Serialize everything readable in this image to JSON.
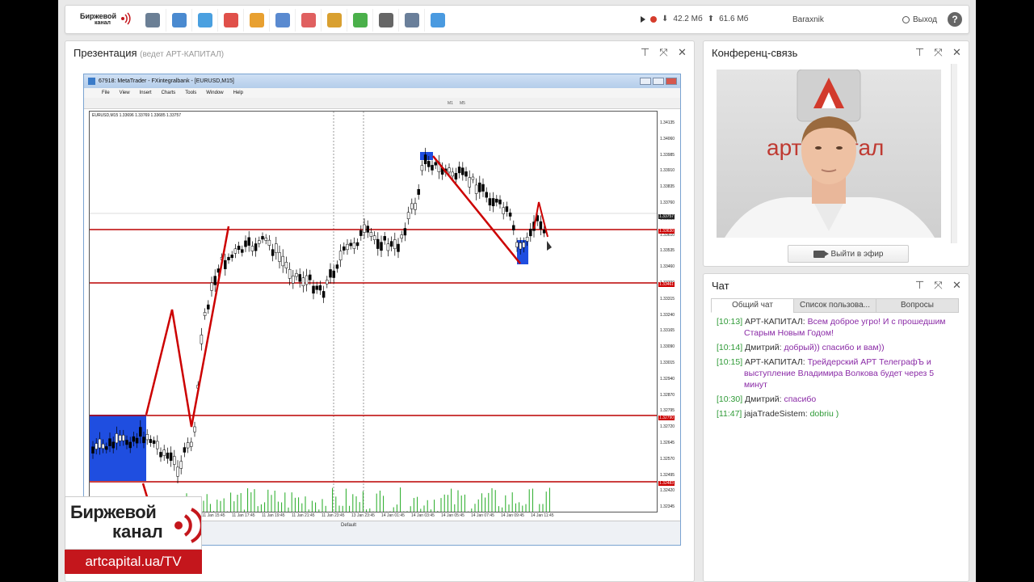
{
  "topbar": {
    "logo_line1": "Биржевой",
    "logo_line2": "канал",
    "tools": [
      "webcam-icon",
      "presentation-icon",
      "chat-bubble-icon",
      "media-icon",
      "folder-icon",
      "document-icon",
      "cube-icon",
      "notepad-icon",
      "share-icon",
      "layout-icon",
      "gear-icon",
      "add-user-icon"
    ],
    "memory_down": "42.2 Мб",
    "memory_up": "61.6 Мб",
    "username": "Baraxnik",
    "exit_label": "Выход",
    "help_label": "?"
  },
  "presentation": {
    "title": "Презентация",
    "subtitle": "(ведет АРТ-КАПИТАЛ)",
    "mt_title": "67918: MetaTrader - FXintegralbank - [EURUSD,M15]",
    "mt_menu": [
      "File",
      "View",
      "Insert",
      "Charts",
      "Tools",
      "Window",
      "Help"
    ],
    "mt_toolbar": [
      "M1",
      "M5"
    ],
    "chart_header": "EURUSD,M15  1.33696 1.33769 1.33685 1.33757",
    "price_ticks": [
      "1.34135",
      "1.34060",
      "1.33985",
      "1.33910",
      "1.33835",
      "1.33760",
      "1.33685",
      "1.33610",
      "1.33535",
      "1.33460",
      "1.33390",
      "1.33315",
      "1.33240",
      "1.33165",
      "1.33090",
      "1.33015",
      "1.32940",
      "1.32870",
      "1.32795",
      "1.32720",
      "1.32645",
      "1.32570",
      "1.32495",
      "1.32420",
      "1.32345"
    ],
    "price_labels": [
      "1.33757",
      "1.33630",
      "1.33461",
      "1.32790",
      "1.32483"
    ],
    "time_ticks": [
      "11 Jan 15:45",
      "11 Jan 17:45",
      "11 Jan 19:45",
      "11 Jan 21:45",
      "11 Jan 23:45",
      "13 Jan 23:45",
      "14 Jan 01:45",
      "14 Jan 03:45",
      "14 Jan 05:45",
      "14 Jan 07:45",
      "14 Jan 09:45",
      "14 Jan 11:45"
    ],
    "status_default": "Default"
  },
  "brand": {
    "line1": "Биржевой",
    "line2": "канал",
    "url": "artcapital.ua/TV"
  },
  "conference": {
    "title": "Конференц-связь",
    "on_air_button": "Выйти в эфир",
    "backdrop_text": "арт капітал"
  },
  "chat": {
    "title": "Чат",
    "tabs": [
      "Общий чат",
      "Список пользова...",
      "Вопросы"
    ],
    "messages": [
      {
        "time": "[10:13]",
        "name": "АРТ-КАПИТАЛ:",
        "text": "Всем доброе угро! И с прошедшим Старым Новым Годом!",
        "green": false
      },
      {
        "time": "[10:14]",
        "name": "Дмитрий:",
        "text": "добрый)) спасибо и вам))",
        "green": false
      },
      {
        "time": "[10:15]",
        "name": "АРТ-КАПИТАЛ:",
        "text": "Трейдерский АРТ ТелеграфЪ и выступление Владимира Волкова будет через 5 минут",
        "green": false
      },
      {
        "time": "[10:30]",
        "name": "Дмитрий:",
        "text": "спасибо",
        "green": false
      },
      {
        "time": "[11:47]",
        "name": "jajaTradeSistem:",
        "text": "dobriu )",
        "green": true
      }
    ]
  },
  "panel_controls": [
    "pin-icon",
    "maximize-icon",
    "close-icon"
  ]
}
